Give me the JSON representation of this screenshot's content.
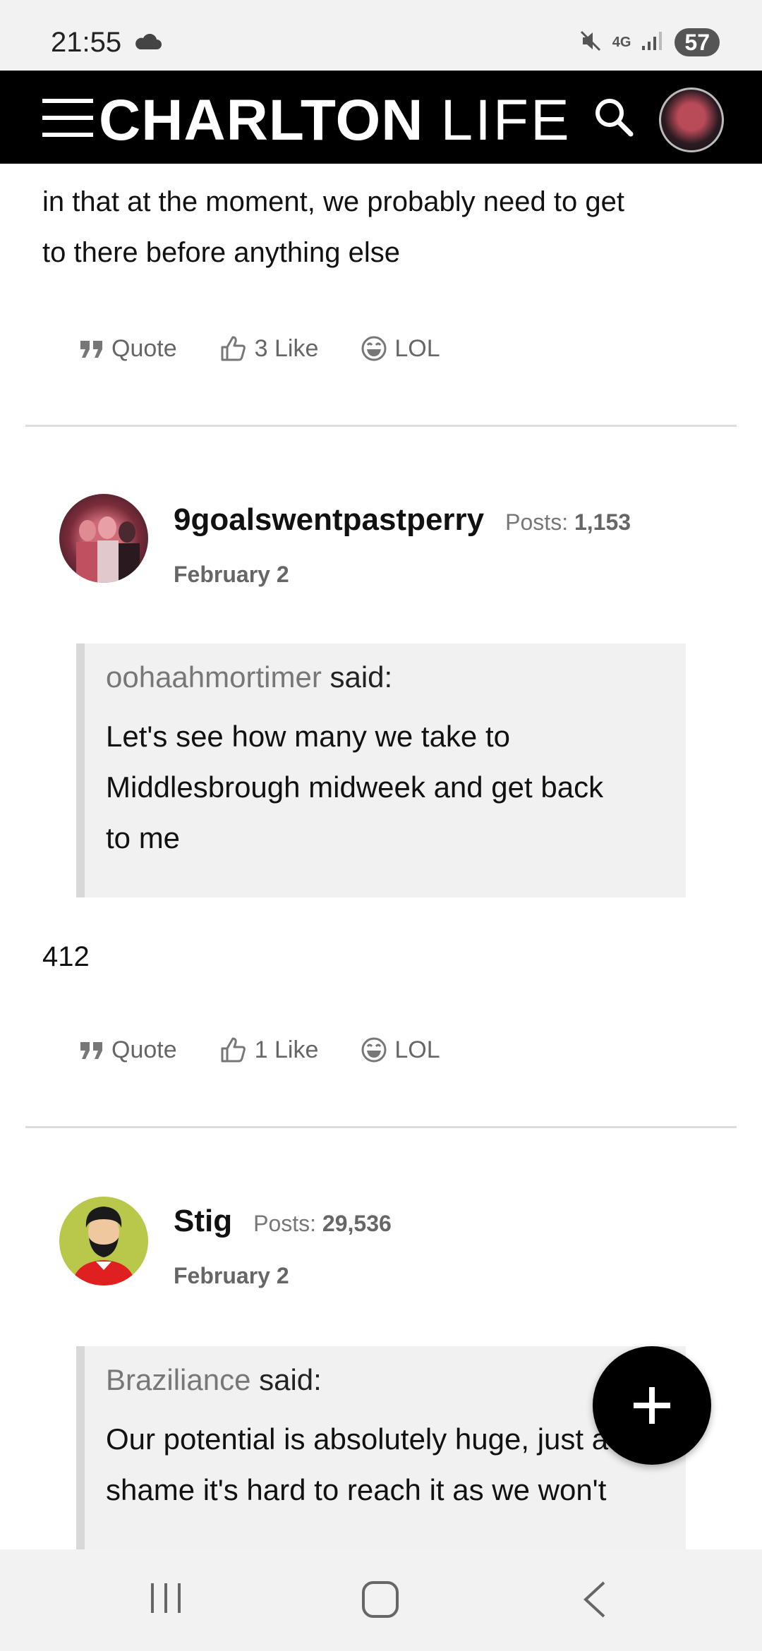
{
  "status_bar": {
    "time": "21:55",
    "network": "4G",
    "battery": "57"
  },
  "header": {
    "logo_bold": "CHARLTON",
    "logo_light": "LIFE"
  },
  "posts": [
    {
      "partial_text_line1": "in that at the moment, we probably need to get",
      "partial_text_line2": "to there before anything else",
      "actions": {
        "quote": "Quote",
        "like": "3 Like",
        "lol": "LOL"
      }
    },
    {
      "username": "9goalswentpastperry",
      "posts_label": "Posts:",
      "posts_count": "1,153",
      "date": "February 2",
      "quote_author": "oohaahmortimer",
      "quote_said": "said:",
      "quote_lines": [
        "Let's see how many we take to",
        "Middlesbrough midweek and get back",
        "to me"
      ],
      "body": "412",
      "actions": {
        "quote": "Quote",
        "like": "1 Like",
        "lol": "LOL"
      }
    },
    {
      "username": "Stig",
      "posts_label": "Posts:",
      "posts_count": "29,536",
      "date": "February 2",
      "quote_author": "Braziliance",
      "quote_said": "said:",
      "quote_lines": [
        "Our potential is absolutely huge, just a",
        "shame it's hard to reach it as we won't"
      ]
    }
  ],
  "icons": {
    "menu": "hamburger-menu-icon",
    "search": "search-icon",
    "quote": "quote-icon",
    "like": "thumbs-up-icon",
    "lol": "laughing-face-icon",
    "fab": "plus-icon"
  }
}
